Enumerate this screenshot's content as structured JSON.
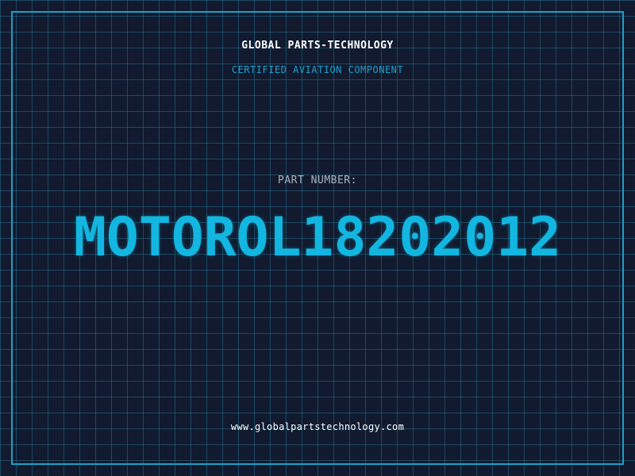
{
  "header": {
    "company": "GLOBAL PARTS-TECHNOLOGY",
    "subtitle": "CERTIFIED AVIATION COMPONENT"
  },
  "part": {
    "label": "PART NUMBER:",
    "number": "MOTOROL18202012"
  },
  "footer": {
    "website": "www.globalpartstechnology.com"
  },
  "colors": {
    "background": "#111a2e",
    "grid": "#266e8c",
    "accent": "#12b6e0",
    "frame": "#1f9fc7",
    "label": "#a8b4c2",
    "text": "#ffffff"
  }
}
